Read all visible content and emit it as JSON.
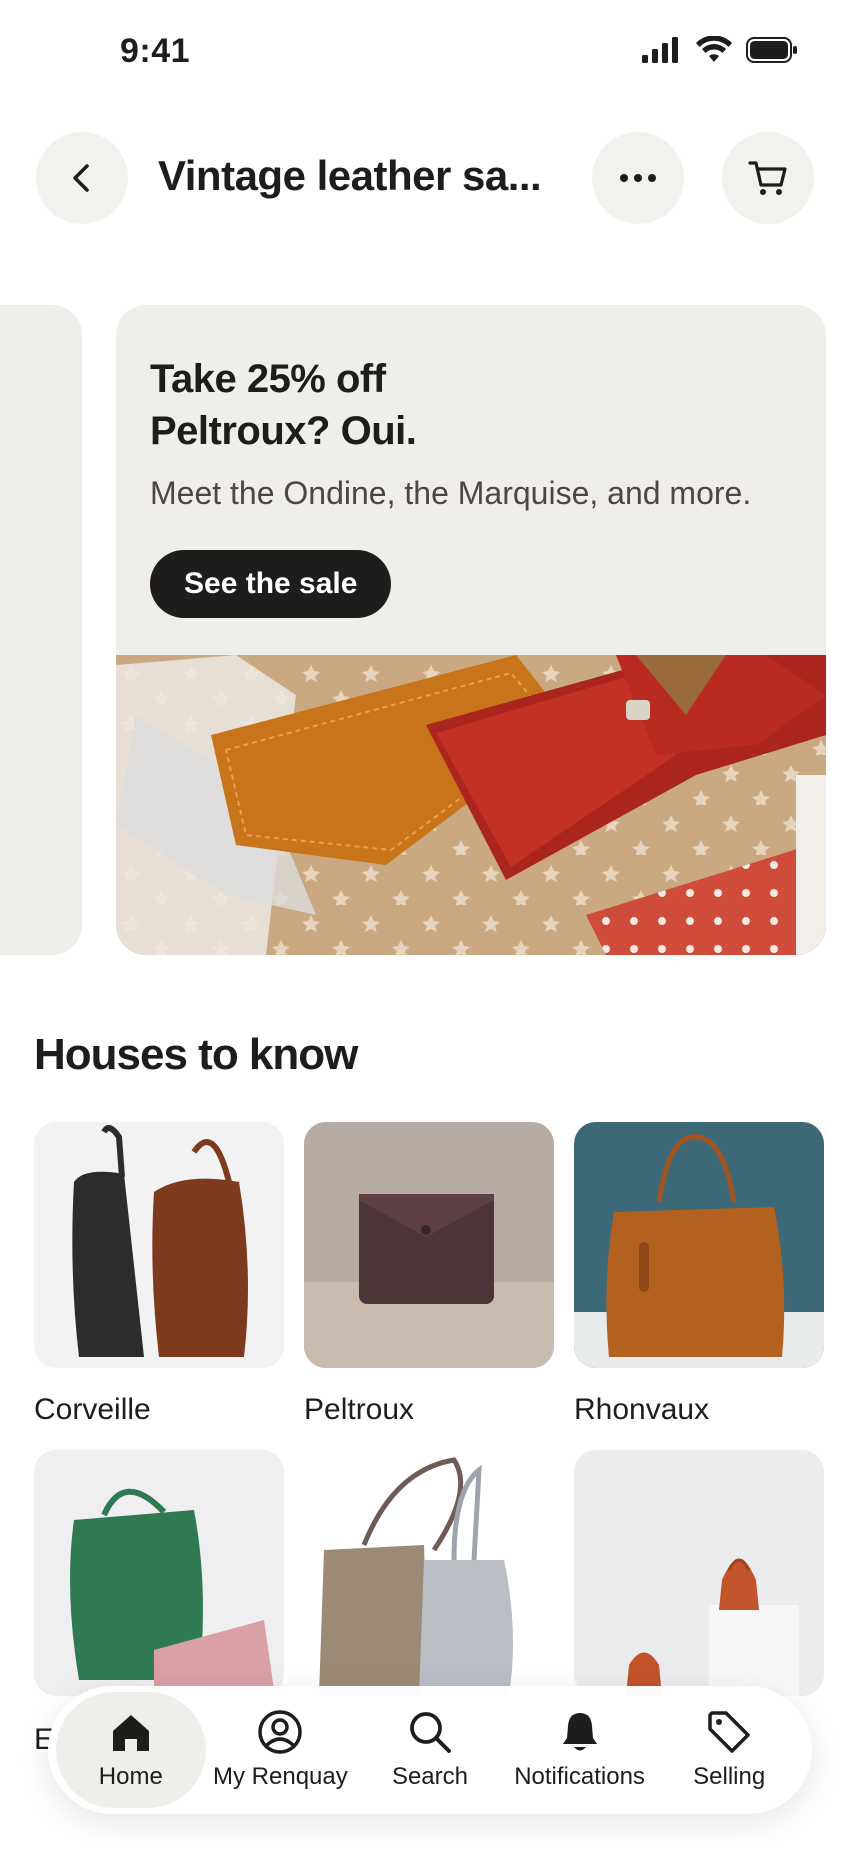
{
  "status_bar": {
    "time": "9:41",
    "icons": [
      "signal-icon",
      "wifi-icon",
      "battery-icon"
    ]
  },
  "header": {
    "title": "Vintage leather sa...",
    "back_icon": "chevron-left-icon",
    "more_icon": "more-horizontal-icon",
    "cart_icon": "cart-icon"
  },
  "promo": {
    "heading_line1": "Take 25% off",
    "heading_line2": "Peltroux? Oui.",
    "subtitle": "Meet the Ondine, the Marquise, and more.",
    "button_label": "See the sale"
  },
  "houses": {
    "title": "Houses to know",
    "items": [
      {
        "label": "Corveille"
      },
      {
        "label": "Peltroux"
      },
      {
        "label": "Rhonvaux"
      },
      {
        "label": "E"
      },
      {
        "label": ""
      },
      {
        "label": ""
      }
    ]
  },
  "bottom_nav": {
    "items": [
      {
        "label": "Home",
        "icon": "home-icon",
        "active": true
      },
      {
        "label": "My Renquay",
        "icon": "profile-icon",
        "active": false
      },
      {
        "label": "Search",
        "icon": "search-icon",
        "active": false
      },
      {
        "label": "Notifications",
        "icon": "bell-icon",
        "active": false
      },
      {
        "label": "Selling",
        "icon": "tag-icon",
        "active": false
      }
    ]
  },
  "colors": {
    "text": "#1f1d1b",
    "surface": "#f0eeeb",
    "button_dark": "#1f1d1b"
  }
}
